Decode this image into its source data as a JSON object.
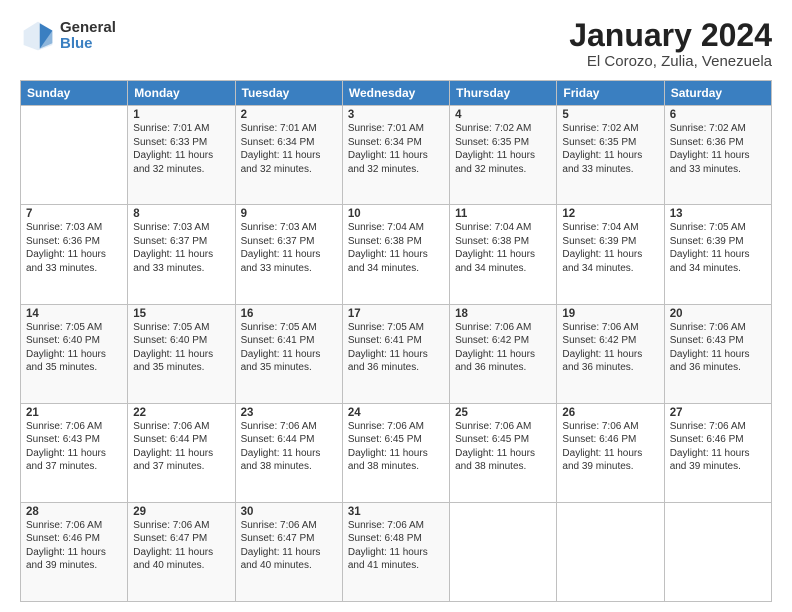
{
  "header": {
    "logo_general": "General",
    "logo_blue": "Blue",
    "month_title": "January 2024",
    "subtitle": "El Corozo, Zulia, Venezuela"
  },
  "calendar": {
    "days_of_week": [
      "Sunday",
      "Monday",
      "Tuesday",
      "Wednesday",
      "Thursday",
      "Friday",
      "Saturday"
    ],
    "weeks": [
      [
        {
          "day": "",
          "info": ""
        },
        {
          "day": "1",
          "info": "Sunrise: 7:01 AM\nSunset: 6:33 PM\nDaylight: 11 hours\nand 32 minutes."
        },
        {
          "day": "2",
          "info": "Sunrise: 7:01 AM\nSunset: 6:34 PM\nDaylight: 11 hours\nand 32 minutes."
        },
        {
          "day": "3",
          "info": "Sunrise: 7:01 AM\nSunset: 6:34 PM\nDaylight: 11 hours\nand 32 minutes."
        },
        {
          "day": "4",
          "info": "Sunrise: 7:02 AM\nSunset: 6:35 PM\nDaylight: 11 hours\nand 32 minutes."
        },
        {
          "day": "5",
          "info": "Sunrise: 7:02 AM\nSunset: 6:35 PM\nDaylight: 11 hours\nand 33 minutes."
        },
        {
          "day": "6",
          "info": "Sunrise: 7:02 AM\nSunset: 6:36 PM\nDaylight: 11 hours\nand 33 minutes."
        }
      ],
      [
        {
          "day": "7",
          "info": "Sunrise: 7:03 AM\nSunset: 6:36 PM\nDaylight: 11 hours\nand 33 minutes."
        },
        {
          "day": "8",
          "info": "Sunrise: 7:03 AM\nSunset: 6:37 PM\nDaylight: 11 hours\nand 33 minutes."
        },
        {
          "day": "9",
          "info": "Sunrise: 7:03 AM\nSunset: 6:37 PM\nDaylight: 11 hours\nand 33 minutes."
        },
        {
          "day": "10",
          "info": "Sunrise: 7:04 AM\nSunset: 6:38 PM\nDaylight: 11 hours\nand 34 minutes."
        },
        {
          "day": "11",
          "info": "Sunrise: 7:04 AM\nSunset: 6:38 PM\nDaylight: 11 hours\nand 34 minutes."
        },
        {
          "day": "12",
          "info": "Sunrise: 7:04 AM\nSunset: 6:39 PM\nDaylight: 11 hours\nand 34 minutes."
        },
        {
          "day": "13",
          "info": "Sunrise: 7:05 AM\nSunset: 6:39 PM\nDaylight: 11 hours\nand 34 minutes."
        }
      ],
      [
        {
          "day": "14",
          "info": "Sunrise: 7:05 AM\nSunset: 6:40 PM\nDaylight: 11 hours\nand 35 minutes."
        },
        {
          "day": "15",
          "info": "Sunrise: 7:05 AM\nSunset: 6:40 PM\nDaylight: 11 hours\nand 35 minutes."
        },
        {
          "day": "16",
          "info": "Sunrise: 7:05 AM\nSunset: 6:41 PM\nDaylight: 11 hours\nand 35 minutes."
        },
        {
          "day": "17",
          "info": "Sunrise: 7:05 AM\nSunset: 6:41 PM\nDaylight: 11 hours\nand 36 minutes."
        },
        {
          "day": "18",
          "info": "Sunrise: 7:06 AM\nSunset: 6:42 PM\nDaylight: 11 hours\nand 36 minutes."
        },
        {
          "day": "19",
          "info": "Sunrise: 7:06 AM\nSunset: 6:42 PM\nDaylight: 11 hours\nand 36 minutes."
        },
        {
          "day": "20",
          "info": "Sunrise: 7:06 AM\nSunset: 6:43 PM\nDaylight: 11 hours\nand 36 minutes."
        }
      ],
      [
        {
          "day": "21",
          "info": "Sunrise: 7:06 AM\nSunset: 6:43 PM\nDaylight: 11 hours\nand 37 minutes."
        },
        {
          "day": "22",
          "info": "Sunrise: 7:06 AM\nSunset: 6:44 PM\nDaylight: 11 hours\nand 37 minutes."
        },
        {
          "day": "23",
          "info": "Sunrise: 7:06 AM\nSunset: 6:44 PM\nDaylight: 11 hours\nand 38 minutes."
        },
        {
          "day": "24",
          "info": "Sunrise: 7:06 AM\nSunset: 6:45 PM\nDaylight: 11 hours\nand 38 minutes."
        },
        {
          "day": "25",
          "info": "Sunrise: 7:06 AM\nSunset: 6:45 PM\nDaylight: 11 hours\nand 38 minutes."
        },
        {
          "day": "26",
          "info": "Sunrise: 7:06 AM\nSunset: 6:46 PM\nDaylight: 11 hours\nand 39 minutes."
        },
        {
          "day": "27",
          "info": "Sunrise: 7:06 AM\nSunset: 6:46 PM\nDaylight: 11 hours\nand 39 minutes."
        }
      ],
      [
        {
          "day": "28",
          "info": "Sunrise: 7:06 AM\nSunset: 6:46 PM\nDaylight: 11 hours\nand 39 minutes."
        },
        {
          "day": "29",
          "info": "Sunrise: 7:06 AM\nSunset: 6:47 PM\nDaylight: 11 hours\nand 40 minutes."
        },
        {
          "day": "30",
          "info": "Sunrise: 7:06 AM\nSunset: 6:47 PM\nDaylight: 11 hours\nand 40 minutes."
        },
        {
          "day": "31",
          "info": "Sunrise: 7:06 AM\nSunset: 6:48 PM\nDaylight: 11 hours\nand 41 minutes."
        },
        {
          "day": "",
          "info": ""
        },
        {
          "day": "",
          "info": ""
        },
        {
          "day": "",
          "info": ""
        }
      ]
    ]
  }
}
